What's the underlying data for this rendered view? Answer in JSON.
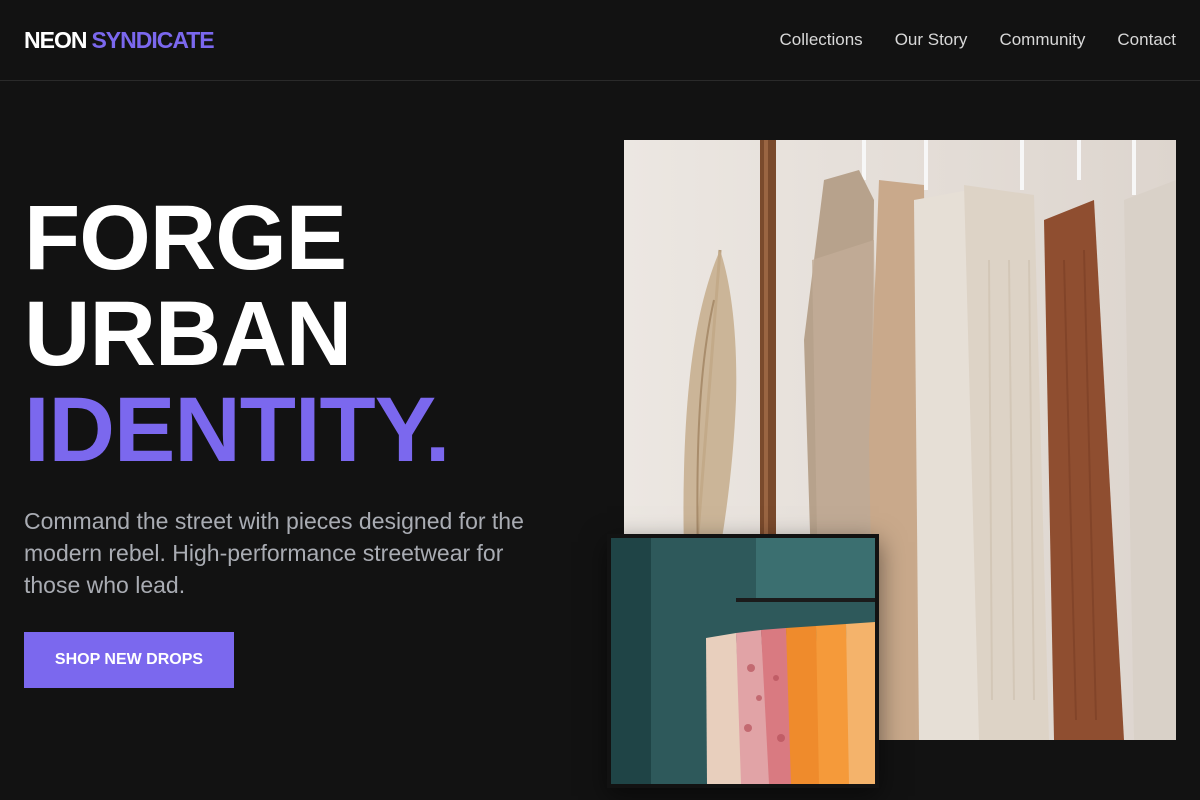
{
  "brand": {
    "word1": "NEON",
    "word2": "SYNDICATE"
  },
  "nav": {
    "items": [
      "Collections",
      "Our Story",
      "Community",
      "Contact"
    ]
  },
  "hero": {
    "title_line1": "FORGE",
    "title_line2": "URBAN",
    "title_line3": "IDENTITY.",
    "subtitle": "Command the street with pieces designed for the modern rebel. High-performance streetwear for those who lead.",
    "cta_label": "SHOP NEW DROPS"
  },
  "colors": {
    "background": "#121212",
    "accent": "#7b68ee",
    "text": "#ffffff",
    "muted": "#a9acb3"
  }
}
